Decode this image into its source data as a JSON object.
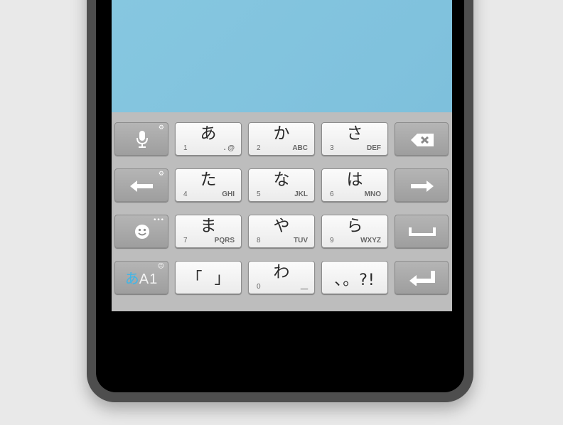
{
  "keyboard": {
    "rows": [
      {
        "left_key": {
          "icon": "microphone-icon",
          "corner": "⚙"
        },
        "keys": [
          {
            "kana": "あ",
            "num": "1",
            "sub": ". @"
          },
          {
            "kana": "か",
            "num": "2",
            "sub": "ABC"
          },
          {
            "kana": "さ",
            "num": "3",
            "sub": "DEF"
          }
        ],
        "right_key": {
          "icon": "backspace-icon"
        }
      },
      {
        "left_key": {
          "icon": "arrow-left-icon",
          "corner": "⚙"
        },
        "keys": [
          {
            "kana": "た",
            "num": "4",
            "sub": "GHI"
          },
          {
            "kana": "な",
            "num": "5",
            "sub": "JKL"
          },
          {
            "kana": "は",
            "num": "6",
            "sub": "MNO"
          }
        ],
        "right_key": {
          "icon": "arrow-right-icon"
        }
      },
      {
        "left_key": {
          "icon": "smiley-icon",
          "corner": "•••"
        },
        "keys": [
          {
            "kana": "ま",
            "num": "7",
            "sub": "PQRS"
          },
          {
            "kana": "や",
            "num": "8",
            "sub": "TUV"
          },
          {
            "kana": "ら",
            "num": "9",
            "sub": "WXYZ"
          }
        ],
        "right_key": {
          "icon": "space-icon"
        }
      },
      {
        "left_key": {
          "label_kana": "あ",
          "label_rest": "A1",
          "corner": "☺"
        },
        "keys": [
          {
            "label": "「  」"
          },
          {
            "kana": "わ",
            "num": "0",
            "sub": "＿"
          },
          {
            "label": "、。?!"
          }
        ],
        "right_key": {
          "icon": "enter-icon"
        }
      }
    ]
  }
}
